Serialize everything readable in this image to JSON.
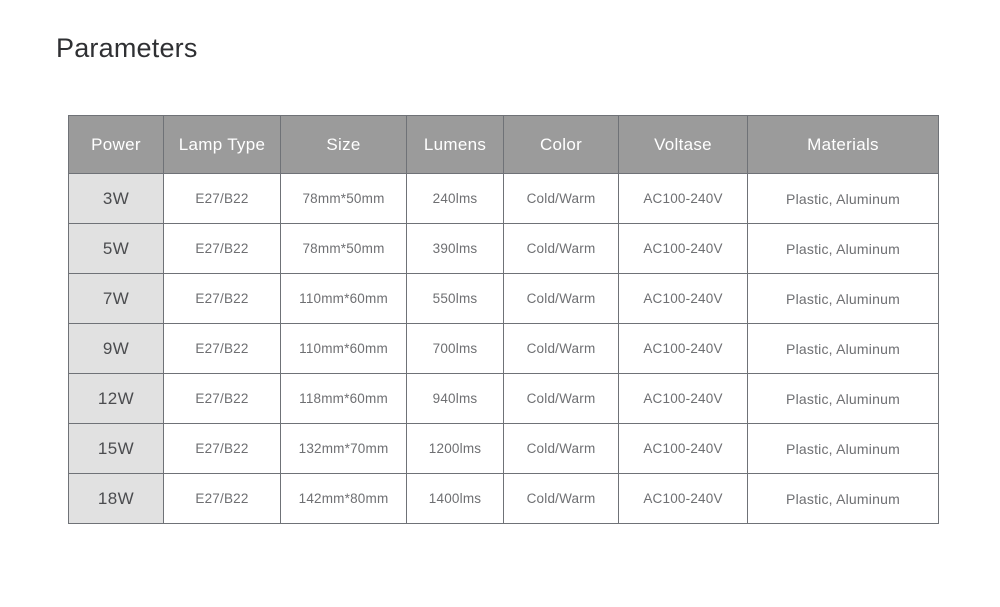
{
  "page": {
    "title": "Parameters",
    "background_color": "#ffffff"
  },
  "colors": {
    "header_background": "#9b9b9b",
    "header_text": "#ffffff",
    "first_column_background": "#e1e1e1",
    "cell_text": "#6e6f72",
    "power_text": "#4b4c4f",
    "border": "#6f7277",
    "title_text": "#2f3033"
  },
  "table": {
    "columns": [
      {
        "key": "power",
        "label": "Power"
      },
      {
        "key": "lamp_type",
        "label": "Lamp Type"
      },
      {
        "key": "size",
        "label": "Size"
      },
      {
        "key": "lumens",
        "label": "Lumens"
      },
      {
        "key": "color",
        "label": "Color"
      },
      {
        "key": "voltage",
        "label": "Voltase"
      },
      {
        "key": "materials",
        "label": "Materials"
      }
    ],
    "rows": [
      {
        "power": "3W",
        "lamp_type": "E27/B22",
        "size": "78mm*50mm",
        "lumens": "240lms",
        "color": "Cold/Warm",
        "voltage": "AC100-240V",
        "materials": "Plastic, Aluminum"
      },
      {
        "power": "5W",
        "lamp_type": "E27/B22",
        "size": "78mm*50mm",
        "lumens": "390lms",
        "color": "Cold/Warm",
        "voltage": "AC100-240V",
        "materials": "Plastic, Aluminum"
      },
      {
        "power": "7W",
        "lamp_type": "E27/B22",
        "size": "110mm*60mm",
        "lumens": "550lms",
        "color": "Cold/Warm",
        "voltage": "AC100-240V",
        "materials": "Plastic, Aluminum"
      },
      {
        "power": "9W",
        "lamp_type": "E27/B22",
        "size": "110mm*60mm",
        "lumens": "700lms",
        "color": "Cold/Warm",
        "voltage": "AC100-240V",
        "materials": "Plastic, Aluminum"
      },
      {
        "power": "12W",
        "lamp_type": "E27/B22",
        "size": "118mm*60mm",
        "lumens": "940lms",
        "color": "Cold/Warm",
        "voltage": "AC100-240V",
        "materials": "Plastic, Aluminum"
      },
      {
        "power": "15W",
        "lamp_type": "E27/B22",
        "size": "132mm*70mm",
        "lumens": "1200lms",
        "color": "Cold/Warm",
        "voltage": "AC100-240V",
        "materials": "Plastic, Aluminum"
      },
      {
        "power": "18W",
        "lamp_type": "E27/B22",
        "size": "142mm*80mm",
        "lumens": "1400lms",
        "color": "Cold/Warm",
        "voltage": "AC100-240V",
        "materials": "Plastic, Aluminum"
      }
    ]
  }
}
